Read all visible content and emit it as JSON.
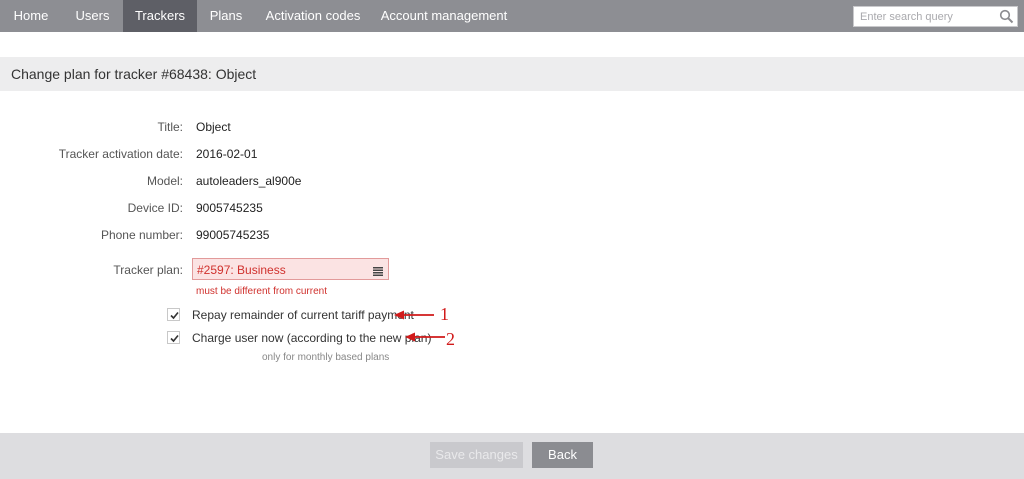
{
  "nav": {
    "items": [
      {
        "label": "Home"
      },
      {
        "label": "Users"
      },
      {
        "label": "Trackers",
        "active": true
      },
      {
        "label": "Plans"
      },
      {
        "label": "Activation codes"
      },
      {
        "label": "Account management"
      }
    ],
    "search": {
      "placeholder": "Enter search query",
      "icon": "search-icon"
    }
  },
  "page": {
    "title": "Change plan for tracker #68438: Object"
  },
  "form": {
    "fields": [
      {
        "label": "Title:",
        "value": "Object"
      },
      {
        "label": "Tracker activation date:",
        "value": "2016-02-01"
      },
      {
        "label": "Model:",
        "value": "autoleaders_al900e"
      },
      {
        "label": "Device ID:",
        "value": "9005745235"
      },
      {
        "label": "Phone number:",
        "value": "99005745235"
      }
    ],
    "plan": {
      "label": "Tracker plan:",
      "value": "#2597: Business",
      "error": "must be different from current",
      "icon": "list-icon"
    },
    "checkboxes": [
      {
        "label": "Repay remainder of current tariff payment",
        "checked": true,
        "annotation": "1"
      },
      {
        "label": "Charge user now (according to the new plan)",
        "checked": true,
        "annotation": "2"
      }
    ],
    "hint": "only for monthly based plans"
  },
  "actions": {
    "save_label": "Save changes",
    "back_label": "Back"
  },
  "colors": {
    "nav_bg": "#8d8e93",
    "nav_active": "#5e5f66",
    "error": "#d0312d",
    "annotation": "#d11a1a"
  }
}
